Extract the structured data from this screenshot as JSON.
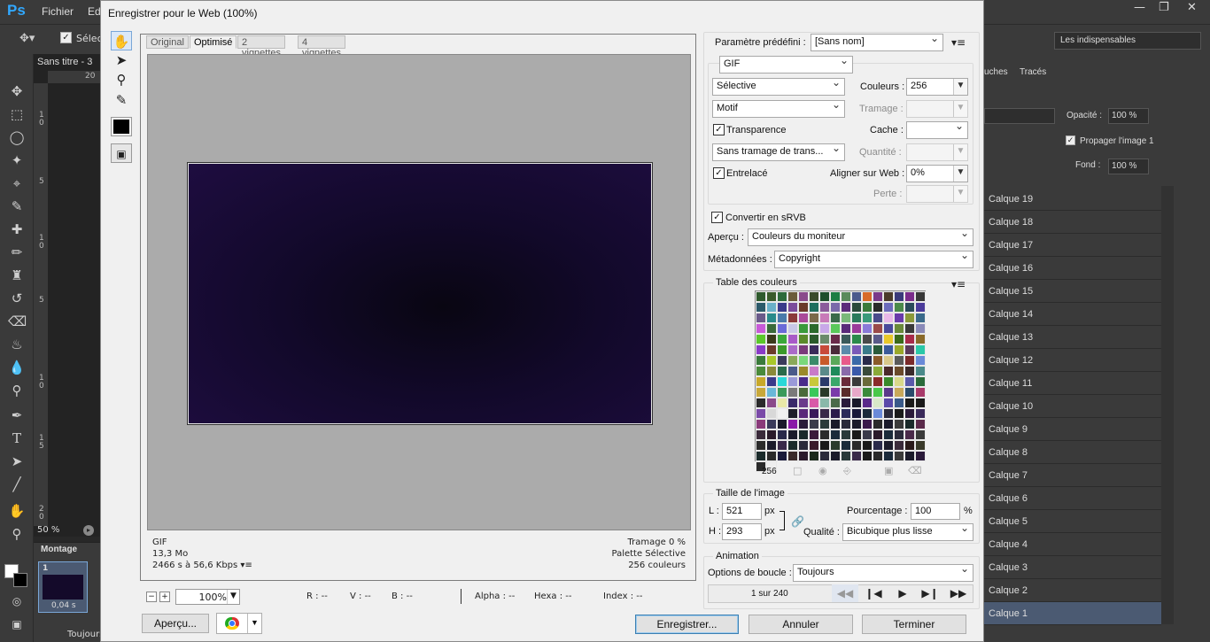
{
  "ps": {
    "menu": [
      "Fichier",
      "Ed"
    ],
    "option_label": "Sélecti",
    "workspace": "Les indispensables",
    "doc_tab": "Sans titre - 3",
    "zoom_status": "50 %",
    "anim_panel_title": "Montage",
    "frame_number": "1",
    "frame_delay": "0,04 s",
    "loop_short": "Toujours",
    "panel_tabs": [
      "uches",
      "Tracés"
    ],
    "opacity_label": "Opacité :",
    "opacity_value": "100 %",
    "propagate_label": "Propager l'image 1",
    "fill_label": "Fond :",
    "fill_value": "100 %",
    "ruler_h": "20",
    "ruler_v": [
      "1",
      "0",
      "5",
      "1",
      "0",
      "5",
      "1",
      "0",
      "1",
      "5",
      "2",
      "0"
    ],
    "layers": [
      "Calque 19",
      "Calque 18",
      "Calque 17",
      "Calque 16",
      "Calque 15",
      "Calque 14",
      "Calque 13",
      "Calque 12",
      "Calque 11",
      "Calque 10",
      "Calque 9",
      "Calque 8",
      "Calque 7",
      "Calque 6",
      "Calque 5",
      "Calque 4",
      "Calque 3",
      "Calque 2",
      "Calque 1"
    ]
  },
  "dialog": {
    "title": "Enregistrer pour le Web (100%)",
    "tabs": [
      "Original",
      "Optimisé",
      "2 vignettes",
      "4 vignettes"
    ],
    "active_tab": "Optimisé",
    "info_left": [
      "GIF",
      "13,3 Mo",
      "2466 s à 56,6 Kbps"
    ],
    "info_right": [
      "Tramage 0 %",
      "Palette Sélective",
      "256 couleurs"
    ],
    "zoom": "100%",
    "readouts": {
      "r": "R : --",
      "v": "V : --",
      "b": "B : --",
      "alpha": "Alpha : --",
      "hexa": "Hexa : --",
      "index": "Index : --"
    },
    "buttons": {
      "apercu": "Aperçu...",
      "enregistrer": "Enregistrer...",
      "annuler": "Annuler",
      "terminer": "Terminer"
    },
    "settings": {
      "preset_label": "Paramètre prédéfini :",
      "preset_value": "[Sans nom]",
      "format": "GIF",
      "reduction": "Sélective",
      "colors_label": "Couleurs :",
      "colors_value": "256",
      "dither": "Motif",
      "dither_amount_label": "Tramage :",
      "transparency_label": "Transparence",
      "matte_label": "Cache :",
      "trans_dither": "Sans tramage de trans...",
      "amount_label": "Quantité :",
      "interlaced_label": "Entrelacé",
      "websnap_label": "Aligner sur Web :",
      "websnap_value": "0%",
      "lossy_label": "Perte :",
      "srgb_label": "Convertir en sRVB",
      "preview_label": "Aperçu :",
      "preview_value": "Couleurs du moniteur",
      "metadata_label": "Métadonnées :",
      "metadata_value": "Copyright"
    },
    "color_table": {
      "title": "Table des couleurs",
      "count": "256",
      "colors": [
        "#2f5a2d",
        "#3a5b2b",
        "#2d6a3a",
        "#6a5b3a",
        "#8a4b8b",
        "#3a4a2a",
        "#1e4f2b",
        "#1c7d43",
        "#5a8a5b",
        "#4b5b8c",
        "#d86a28",
        "#7a3a8a",
        "#4b3b2a",
        "#3a3a7a",
        "#7a2b8a",
        "#383838",
        "#2c5a6a",
        "#6ab0c8",
        "#3a3a8a",
        "#7b4b9b",
        "#6a3a2a",
        "#1e6e5e",
        "#8b5b9b",
        "#7a6aaa",
        "#5b2b7a",
        "#2a4a3a",
        "#3a7a3a",
        "#2a2a2a",
        "#6b6bbb",
        "#4a8a4a",
        "#2a4a5a",
        "#4b3b9b",
        "#6a5a8a",
        "#2a8a8a",
        "#4a7aaa",
        "#8a3a3a",
        "#aa4a9a",
        "#7a6a4a",
        "#c87ab8",
        "#3a6a4a",
        "#7ab87a",
        "#2b7a5b",
        "#3a9a7a",
        "#4b4b8b",
        "#e8b8e8",
        "#6a3aaa",
        "#8a9a3a",
        "#3a6a8a",
        "#c85ad8",
        "#3a6a3a",
        "#6a6ad8",
        "#c8c8e8",
        "#3a9a3a",
        "#2a6a2a",
        "#c8a8e8",
        "#5ac85a",
        "#5a2a7a",
        "#9a3a9a",
        "#8a7ad8",
        "#9a4a4a",
        "#4a4a9a",
        "#6a8a3a",
        "#3a3a3a",
        "#8a8ab8",
        "#5ac82a",
        "#3a3a1a",
        "#3aa83a",
        "#a85ac8",
        "#5a8a2a",
        "#2a5a2a",
        "#6a8a6a",
        "#6a2a4a",
        "#3a5a5a",
        "#2a8a4a",
        "#4a4a4a",
        "#5a5a8a",
        "#e8c82a",
        "#3a6a1a",
        "#a82a4a",
        "#8a6a2a",
        "#8a3ac8",
        "#6a3a2a",
        "#3a9a2a",
        "#aa6ac8",
        "#7a3a7a",
        "#3a2a5a",
        "#c84a3a",
        "#4a2a3a",
        "#5a8aaa",
        "#7a5ab8",
        "#3a7a8a",
        "#2a5a3a",
        "#3a5a9a",
        "#9aa82a",
        "#5a3a5a",
        "#2ac8a8",
        "#3a7a3a",
        "#a8c82a",
        "#3a3a5a",
        "#8aa85a",
        "#7ad87a",
        "#3a8a6a",
        "#c85a2a",
        "#5aa85a",
        "#e85a8a",
        "#3a6aa8",
        "#2a2a4a",
        "#8a5a2a",
        "#d8c88a",
        "#5a5a5a",
        "#7a2a2a",
        "#6a8ad8",
        "#4a8a3a",
        "#8a8a3a",
        "#2a6a4a",
        "#4a5a8a",
        "#9a8a2a",
        "#c87ac8",
        "#5a8a8a",
        "#1e8a5a",
        "#8a6aaa",
        "#3a5aaa",
        "#3a4a3a",
        "#8aaa3a",
        "#4a2a2a",
        "#6a4a2a",
        "#3a2a2a",
        "#4a8a8a",
        "#c8a82a",
        "#3a3a8a",
        "#2ad8d8",
        "#9a9ad8",
        "#4a2a8a",
        "#c8c83a",
        "#2a3a6a",
        "#3aa86a",
        "#6a2a3a",
        "#3a3a3a",
        "#6a6a3a",
        "#8a2a2a",
        "#3a8a2a",
        "#d8d88a",
        "#5a5aaa",
        "#2a6a3a",
        "#c8a83a",
        "#6ab8d8",
        "#3a9a5a",
        "#7a7a7a",
        "#4a6a3a",
        "#3ac85a",
        "#2a3a2a",
        "#7a3aaa",
        "#5a2a2a",
        "#e8a8c8",
        "#3a8a3a",
        "#4ac84a",
        "#5a3a8a",
        "#c8a85a",
        "#2a4a6a",
        "#a83a6a",
        "#2a2a2a",
        "#8a4a8a",
        "#e8e8a8",
        "#3a2a6a",
        "#6a3a8a",
        "#d85aa8",
        "#8ab8aa",
        "#4a6a4a",
        "#2a1a3a",
        "#1a1a2a",
        "#5a2a8a",
        "#d8e8c8",
        "#5a4aa8",
        "#3a5a8a",
        "#1a1a1a",
        "#1a1a1a",
        "#7a4aa8",
        "#d8d8d8",
        "#f0f0f0",
        "#1e1e2a",
        "#5a2a7a",
        "#3a1a5a",
        "#3a2a4a",
        "#2a1a4a",
        "#2a2a5a",
        "#1a1a3a",
        "#1a2a3a",
        "#6a8ad8",
        "#2a2a3a",
        "#1a1a1a",
        "#2a1a3a",
        "#3a2a5a",
        "#8a3a7a",
        "#3a3a5a",
        "#1a1a2a",
        "#8a1aa8",
        "#2a1a3a",
        "#3a3a4a",
        "#2a3a3a",
        "#1a1a2a",
        "#2a2a3a",
        "#1a1a2a",
        "#3a1a4a",
        "#2a2a2a",
        "#1a1a2a",
        "#3a3a3a",
        "#1a2a2a",
        "#5a2a4a",
        "#3a2a3a",
        "#2a1a2a",
        "#2a2a4a",
        "#1a1a2a",
        "#1a2a2a",
        "#3a1a3a",
        "#2a2a2a",
        "#1a2a3a",
        "#2a3a3a",
        "#1a1a1a",
        "#3a3a4a",
        "#2a1a2a",
        "#1a2a3a",
        "#2a2a3a",
        "#4a2a4a",
        "#3a3a3a",
        "#2a2a2a",
        "#1a1a2a",
        "#3a2a4a",
        "#1a2a2a",
        "#2a2a3a",
        "#3a1a2a",
        "#1a1a1a",
        "#2a3a2a",
        "#1a2a3a",
        "#2a2a2a",
        "#1a1a1a",
        "#2a2a4a",
        "#1a1a2a",
        "#3a2a3a",
        "#2a1a1a",
        "#3a3a2a",
        "#1a2a2a",
        "#2a2a2a",
        "#1a1a3a",
        "#3a2a2a",
        "#2a1a2a",
        "#1a2a1a",
        "#2a2a3a",
        "#1a1a2a",
        "#2a3a3a",
        "#3a2a4a",
        "#1a1a1a",
        "#2a2a2a",
        "#1a2a3a",
        "#3a3a3a",
        "#1a1a2a",
        "#2a1a3a",
        "#2a2a2a",
        "#eeeeee"
      ]
    },
    "image_size": {
      "title": "Taille de l'image",
      "w_label": "L :",
      "w_value": "521",
      "h_label": "H :",
      "h_value": "293",
      "unit": "px",
      "percent_label": "Pourcentage :",
      "percent_value": "100",
      "percent_unit": "%",
      "quality_label": "Qualité :",
      "quality_value": "Bicubique plus lisse"
    },
    "animation": {
      "title": "Animation",
      "loop_label": "Options de boucle :",
      "loop_value": "Toujours",
      "frame_counter": "1 sur 240"
    }
  }
}
